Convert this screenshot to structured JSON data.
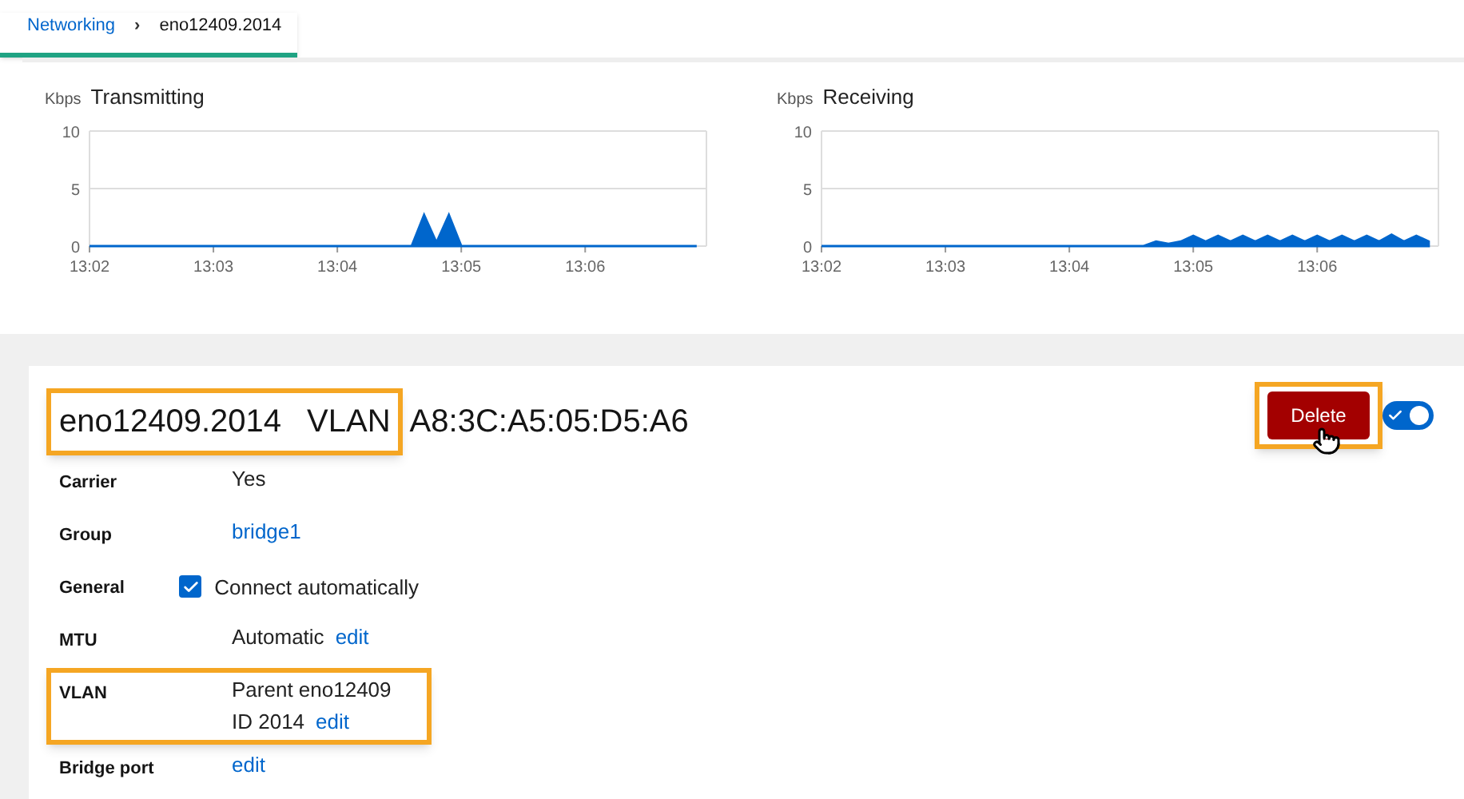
{
  "breadcrumb": {
    "link": "Networking",
    "separator": "›",
    "current": "eno12409.2014"
  },
  "charts": [
    {
      "unit": "Kbps",
      "chart_data": {
        "type": "area",
        "categories": [
          "13:02",
          null,
          null,
          null,
          null,
          null,
          null,
          null,
          null,
          null,
          "13:03",
          null,
          null,
          null,
          null,
          null,
          null,
          null,
          null,
          null,
          "13:04",
          null,
          null,
          null,
          null,
          null,
          null,
          null,
          null,
          null,
          "13:05",
          null,
          null,
          null,
          null,
          null,
          null,
          null,
          null,
          null,
          "13:06",
          null,
          null,
          null,
          null,
          null,
          null,
          null,
          null,
          null
        ],
        "series": [
          {
            "name": "Transmitting",
            "color": "#0066cc",
            "values": [
              0,
              0,
              0,
              0,
              0,
              0,
              0,
              0,
              0,
              0,
              0,
              0,
              0,
              0,
              0,
              0,
              0,
              0,
              0,
              0,
              0,
              0,
              0,
              0,
              0,
              0,
              0,
              2.7,
              0.3,
              2.7,
              0,
              0,
              0,
              0,
              0,
              0,
              0,
              0,
              0,
              0,
              0,
              0,
              0,
              0,
              0,
              0,
              0,
              0,
              0,
              0
            ]
          }
        ],
        "ylim": [
          0,
          10
        ],
        "yticks": [
          0,
          5,
          10
        ]
      }
    },
    {
      "unit": "Kbps",
      "chart_data": {
        "type": "area",
        "categories": [
          "13:02",
          null,
          null,
          null,
          null,
          null,
          null,
          null,
          null,
          null,
          "13:03",
          null,
          null,
          null,
          null,
          null,
          null,
          null,
          null,
          null,
          "13:04",
          null,
          null,
          null,
          null,
          null,
          null,
          null,
          null,
          null,
          "13:05",
          null,
          null,
          null,
          null,
          null,
          null,
          null,
          null,
          null,
          "13:06",
          null,
          null,
          null,
          null,
          null,
          null,
          null,
          null,
          null
        ],
        "series": [
          {
            "name": "Receiving",
            "color": "#0066cc",
            "values": [
              0,
              0,
              0,
              0,
              0,
              0,
              0,
              0,
              0,
              0,
              0,
              0,
              0,
              0,
              0,
              0,
              0,
              0,
              0,
              0,
              0,
              0,
              0,
              0,
              0,
              0,
              0,
              0.4,
              0.2,
              0.4,
              0.9,
              0.4,
              0.9,
              0.4,
              0.9,
              0.4,
              0.9,
              0.4,
              0.9,
              0.4,
              0.9,
              0.4,
              0.9,
              0.4,
              0.9,
              0.4,
              1.0,
              0.4,
              0.9,
              0.4
            ]
          }
        ],
        "ylim": [
          0,
          10
        ],
        "yticks": [
          0,
          5,
          10
        ]
      }
    }
  ],
  "header": {
    "name": "eno12409.2014",
    "type": "VLAN",
    "mac": "A8:3C:A5:05:D5:A6",
    "highlighted": true
  },
  "delete_button": {
    "label": "Delete",
    "highlighted": true
  },
  "toggle": {
    "on": true
  },
  "rows": [
    {
      "label": "Carrier",
      "kind": "text",
      "highlighted": false,
      "lines": [
        [
          {
            "kind": "text",
            "text": "Yes"
          }
        ]
      ]
    },
    {
      "label": "Group",
      "kind": "text",
      "highlighted": false,
      "lines": [
        [
          {
            "kind": "link",
            "text": "bridge1"
          }
        ]
      ]
    },
    {
      "label": "General",
      "kind": "checkbox",
      "highlighted": false,
      "checkbox": {
        "label": "Connect automatically",
        "checked": true
      }
    },
    {
      "label": "MTU",
      "kind": "text",
      "highlighted": false,
      "lines": [
        [
          {
            "kind": "text",
            "text": "Automatic"
          },
          {
            "kind": "link",
            "text": "edit"
          }
        ]
      ]
    },
    {
      "label": "VLAN",
      "kind": "text",
      "highlighted": true,
      "lines": [
        [
          {
            "kind": "text",
            "text": "Parent eno12409"
          }
        ],
        [
          {
            "kind": "text",
            "text": "ID 2014"
          },
          {
            "kind": "link",
            "text": "edit"
          }
        ]
      ]
    },
    {
      "label": "Bridge port",
      "kind": "text",
      "highlighted": false,
      "lines": [
        [
          {
            "kind": "link",
            "text": "edit"
          }
        ]
      ]
    }
  ]
}
